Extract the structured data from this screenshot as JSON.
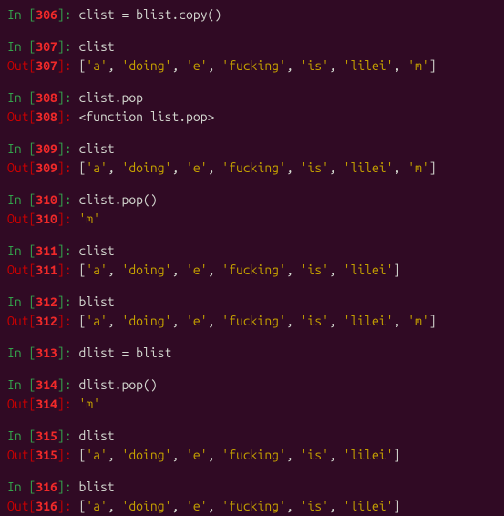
{
  "cells": [
    {
      "num": "306",
      "input": "clist = blist.copy()",
      "output": null,
      "gap": true
    },
    {
      "num": "307",
      "input": "clist",
      "output": "['a', 'doing', 'e', 'fucking', 'is', 'lilei', 'm']",
      "output_is_list": true,
      "gap": true
    },
    {
      "num": "308",
      "input": "clist.pop",
      "output": "<function list.pop>",
      "output_is_list": false,
      "gap": true
    },
    {
      "num": "309",
      "input": "clist",
      "output": "['a', 'doing', 'e', 'fucking', 'is', 'lilei', 'm']",
      "output_is_list": true,
      "gap": true
    },
    {
      "num": "310",
      "input": "clist.pop()",
      "output": "'m'",
      "output_is_str": true,
      "gap": true
    },
    {
      "num": "311",
      "input": "clist",
      "output": "['a', 'doing', 'e', 'fucking', 'is', 'lilei']",
      "output_is_list": true,
      "gap": true
    },
    {
      "num": "312",
      "input": "blist",
      "output": "['a', 'doing', 'e', 'fucking', 'is', 'lilei', 'm']",
      "output_is_list": true,
      "gap": true
    },
    {
      "num": "313",
      "input": "dlist = blist",
      "output": null,
      "gap": true
    },
    {
      "num": "314",
      "input": "dlist.pop()",
      "output": "'m'",
      "output_is_str": true,
      "gap": true
    },
    {
      "num": "315",
      "input": "dlist",
      "output": "['a', 'doing', 'e', 'fucking', 'is', 'lilei']",
      "output_is_list": true,
      "gap": true
    },
    {
      "num": "316",
      "input": "blist",
      "output": "['a', 'doing', 'e', 'fucking', 'is', 'lilei']",
      "output_is_list": true,
      "gap": false
    }
  ],
  "labels": {
    "in": "In ",
    "out": "Out"
  }
}
